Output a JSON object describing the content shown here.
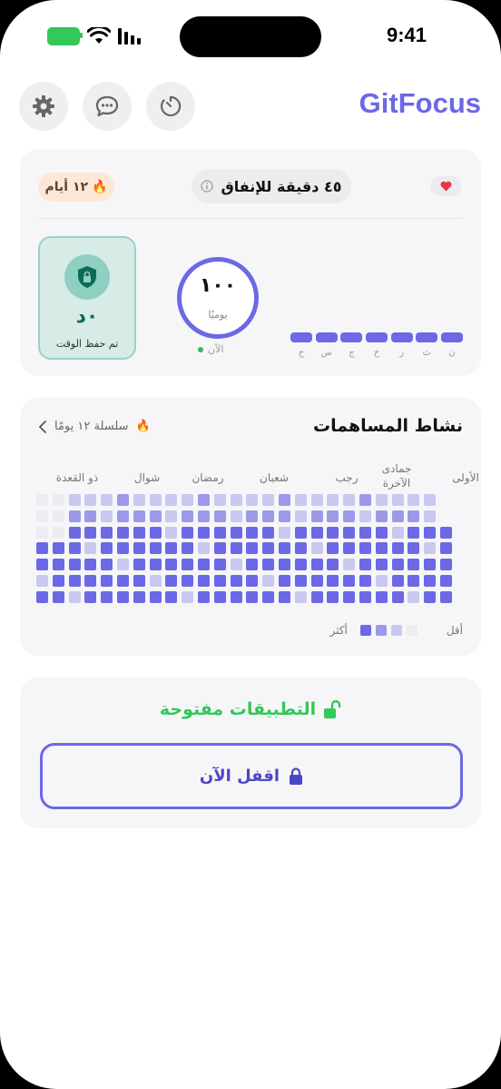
{
  "status_bar": {
    "time": "9:41"
  },
  "app": {
    "brand": "GitFocus"
  },
  "icons": {
    "settings": "gear-icon",
    "chat": "chat-bubble-icon",
    "timer": "timer-icon"
  },
  "colors": {
    "accent": "#6c68e6",
    "green": "#34c759",
    "teal": "#0f6a55"
  },
  "summary": {
    "streak_label": "١٢ أيام",
    "spend_label": "٤٥ دقيقة للإنفاق",
    "saved_value": "٠د",
    "saved_label": "تم حفظ الوقت",
    "daily_value": "١٠٠",
    "daily_label": "يوميًا",
    "now_label": "الآن",
    "week_days": [
      "ن",
      "ث",
      "ر",
      "خ",
      "ج",
      "س",
      "ح"
    ]
  },
  "activity": {
    "title": "نشاط المساهمات",
    "streak_label": "سلسلة ١٢ يومًا",
    "months": [
      "الأولى",
      "جمادى\nالآخرة",
      "رجب",
      "شعبان",
      "رمضان",
      "شوال",
      "ذو القعدة"
    ],
    "legend_less": "أقل",
    "legend_more": "أكثر"
  },
  "lock": {
    "status": "التطبيقات مفتوحة",
    "button_label": "اقفل الآن"
  }
}
